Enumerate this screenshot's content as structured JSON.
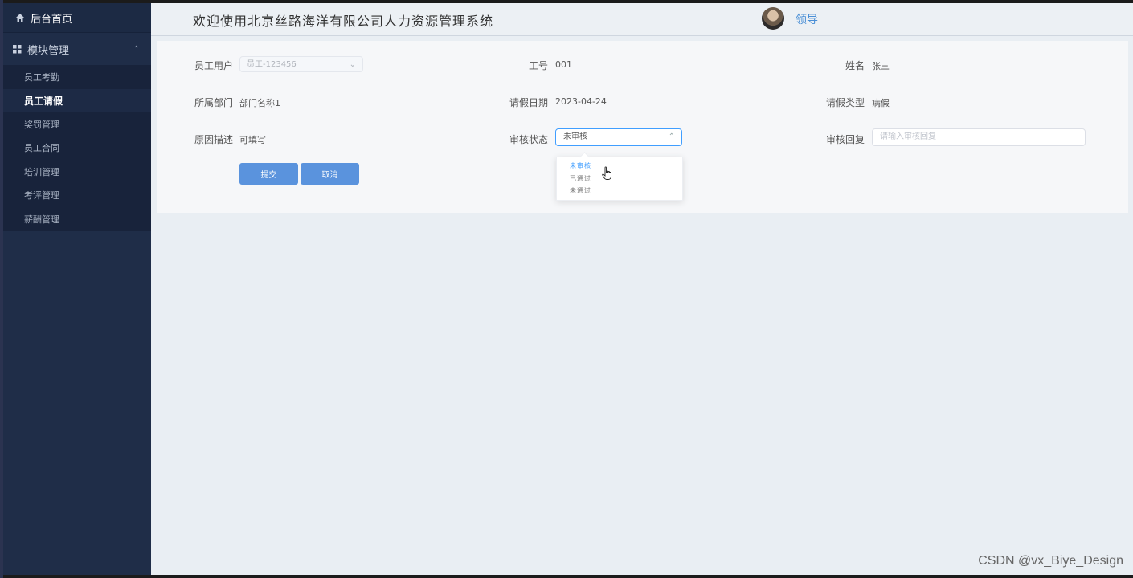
{
  "sidebar": {
    "home_label": "后台首页",
    "group_label": "模块管理",
    "items": [
      {
        "label": "员工考勤"
      },
      {
        "label": "员工请假"
      },
      {
        "label": "奖罚管理"
      },
      {
        "label": "员工合同"
      },
      {
        "label": "培训管理"
      },
      {
        "label": "考评管理"
      },
      {
        "label": "薪酬管理"
      }
    ]
  },
  "header": {
    "title": "欢迎使用北京丝路海洋有限公司人力资源管理系统",
    "user": "领导"
  },
  "form": {
    "employee_user": {
      "label": "员工用户",
      "value": "员工-123456"
    },
    "job_no": {
      "label": "工号",
      "value": "001"
    },
    "name": {
      "label": "姓名",
      "value": "张三"
    },
    "department": {
      "label": "所属部门",
      "value": "部门名称1"
    },
    "leave_date": {
      "label": "请假日期",
      "value": "2023-04-24"
    },
    "leave_type": {
      "label": "请假类型",
      "value": "病假"
    },
    "reason": {
      "label": "原因描述",
      "value": "可填写"
    },
    "review_status": {
      "label": "审核状态",
      "value": "未审核",
      "options": [
        "未审核",
        "已通过",
        "未通过"
      ]
    },
    "review_reply": {
      "label": "审核回复",
      "placeholder": "请输入审核回复"
    },
    "submit_label": "提交",
    "cancel_label": "取消"
  },
  "watermark": "CSDN @vx_Biye_Design",
  "colors": {
    "sidebar_bg": "#1f2d48",
    "accent": "#409eff",
    "button": "#5a93dd"
  }
}
